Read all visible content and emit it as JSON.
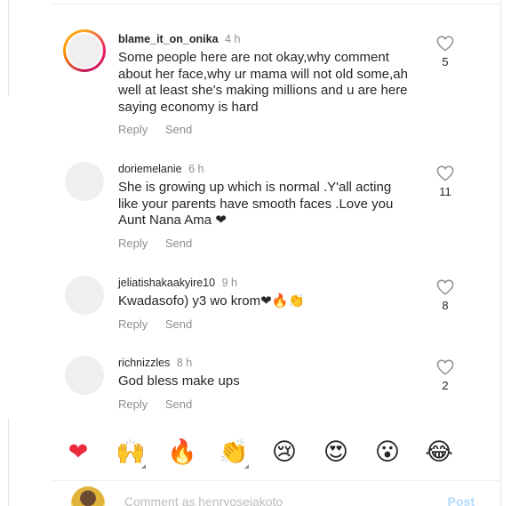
{
  "comments": [
    {
      "username": "blame_it_on_onika",
      "time": "4 h",
      "text": "Some people here are not okay,why comment about her face,why ur mama will not old some,ah well at least she's making millions and u are here saying economy is hard",
      "reply": "Reply",
      "send": "Send",
      "likes": "5",
      "story_ring": true
    },
    {
      "username": "doriemelanie",
      "time": "6 h",
      "text": "She is growing up which is normal .Y'all acting like your parents have smooth faces .Love you Aunt Nana Ama ❤",
      "reply": "Reply",
      "send": "Send",
      "likes": "11"
    },
    {
      "username": "jeliatishakaakyire10",
      "time": "9 h",
      "text": "Kwadasofo) y3 wo krom❤🔥👏",
      "reply": "Reply",
      "send": "Send",
      "likes": "8"
    },
    {
      "username": "richnizzles",
      "time": "8 h",
      "text": "God bless make ups",
      "reply": "Reply",
      "send": "Send",
      "likes": "2"
    }
  ],
  "emoji_bar": [
    "❤",
    "🙌",
    "🔥",
    "👏",
    "😢",
    "😍",
    "😮",
    "😂"
  ],
  "composer": {
    "placeholder": "Comment as henryosejakoto",
    "post_label": "Post"
  }
}
